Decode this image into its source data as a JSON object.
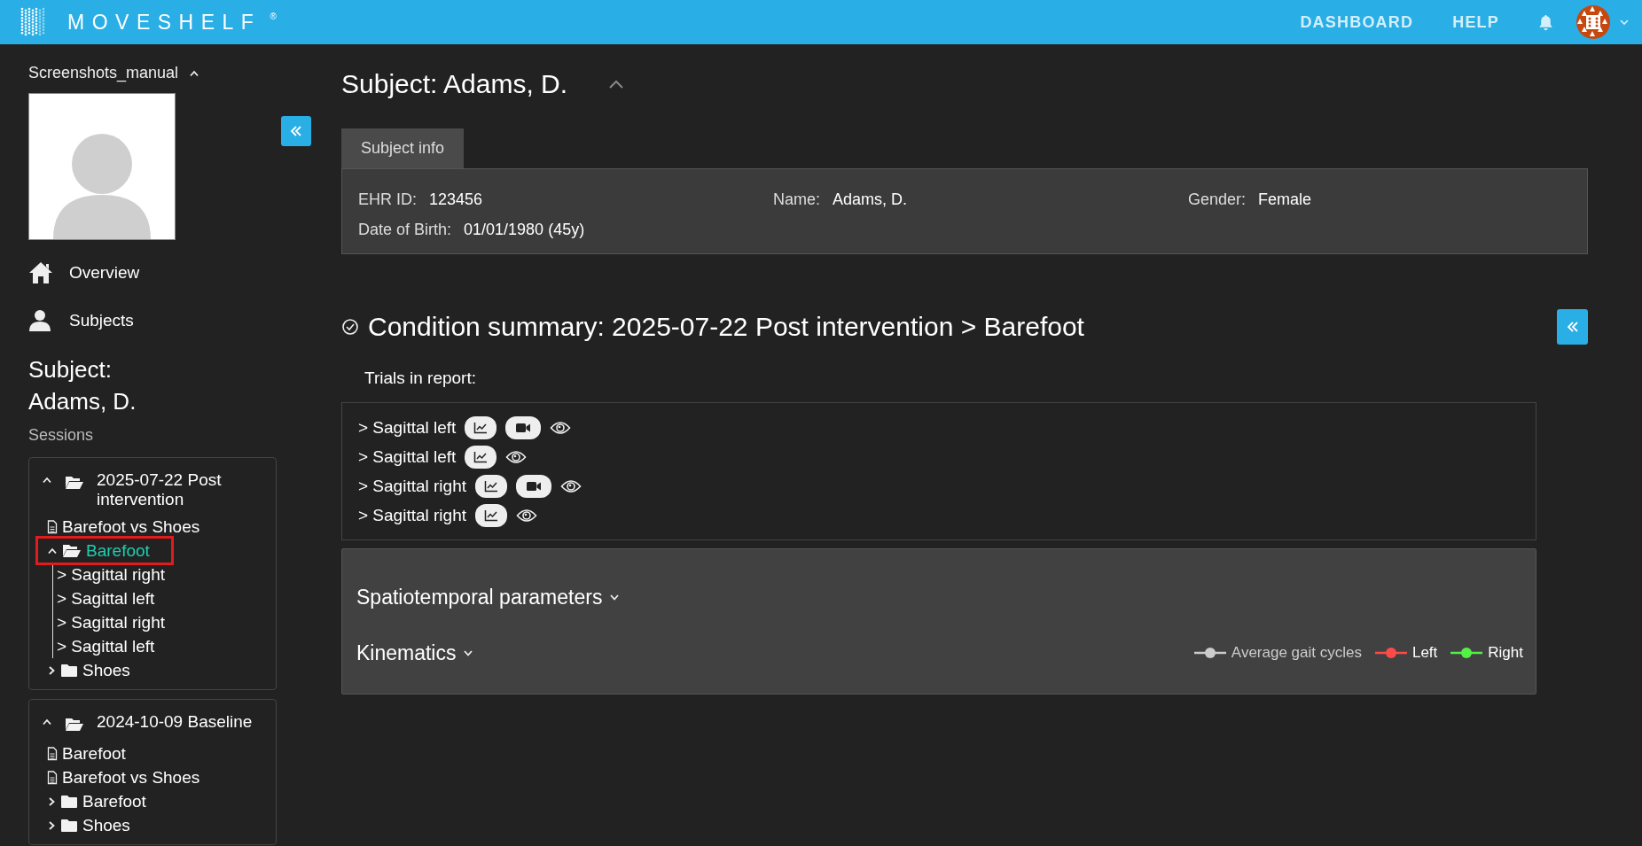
{
  "header": {
    "logo": "MOVESHELF",
    "logo_mark": "®",
    "nav": [
      {
        "label": "DASHBOARD"
      },
      {
        "label": "HELP"
      }
    ]
  },
  "sidebar": {
    "project": "Screenshots_manual",
    "nav": [
      {
        "label": "Overview",
        "kind": "home"
      },
      {
        "label": "Subjects",
        "kind": "person"
      }
    ],
    "subject": "Subject: Adams, D.",
    "sessions_label": "Sessions",
    "sessions": [
      {
        "label": "2025-07-22 Post intervention",
        "kind": "session",
        "expanded": true,
        "children": [
          {
            "label": "Barefoot vs Shoes",
            "kind": "report",
            "selected": false
          },
          {
            "label": "Barefoot",
            "kind": "folder",
            "expanded": true,
            "selected": true,
            "children": [
              {
                "label": "> Sagittal right",
                "kind": "trial",
                "selected": false
              },
              {
                "label": "> Sagittal left",
                "kind": "trial",
                "selected": false
              },
              {
                "label": "> Sagittal right",
                "kind": "trial",
                "selected": false
              },
              {
                "label": "> Sagittal left",
                "kind": "trial",
                "selected": false
              }
            ]
          },
          {
            "label": "Shoes",
            "kind": "folder",
            "expanded": false,
            "selected": false
          }
        ]
      },
      {
        "label": "2024-10-09 Baseline",
        "kind": "session",
        "expanded": true,
        "children": [
          {
            "label": "Barefoot",
            "kind": "report",
            "selected": false
          },
          {
            "label": "Barefoot vs Shoes",
            "kind": "report",
            "selected": false
          },
          {
            "label": "Barefoot",
            "kind": "folder",
            "expanded": false,
            "selected": false
          },
          {
            "label": "Shoes",
            "kind": "folder",
            "expanded": false,
            "selected": false
          }
        ]
      }
    ]
  },
  "subject": {
    "title": "Subject: Adams, D.",
    "tabs": [
      {
        "label": "Subject info",
        "selected": true
      }
    ],
    "fields": [
      {
        "label": "EHR ID:",
        "value": "123456"
      },
      {
        "label": "Name:",
        "value": "Adams, D."
      },
      {
        "label": "Gender:",
        "value": "Female"
      },
      {
        "label": "Date of Birth:",
        "value": "01/01/1980 (45y)"
      }
    ]
  },
  "condition": {
    "title": "Condition summary: 2025-07-22 Post intervention > Barefoot",
    "trials_label": "Trials in report:",
    "trials": [
      {
        "label": "> Sagittal left",
        "video": true
      },
      {
        "label": "> Sagittal left",
        "video": false
      },
      {
        "label": "> Sagittal right",
        "video": true
      },
      {
        "label": "> Sagittal right",
        "video": false
      }
    ],
    "sections": [
      {
        "label": "Spatiotemporal parameters"
      },
      {
        "label": "Kinematics"
      }
    ],
    "legend": [
      {
        "label": "Average gait cycles",
        "color": "#cccccc"
      },
      {
        "label": "Left",
        "color": "#ff4a4a"
      },
      {
        "label": "Right",
        "color": "#55f046"
      }
    ]
  }
}
